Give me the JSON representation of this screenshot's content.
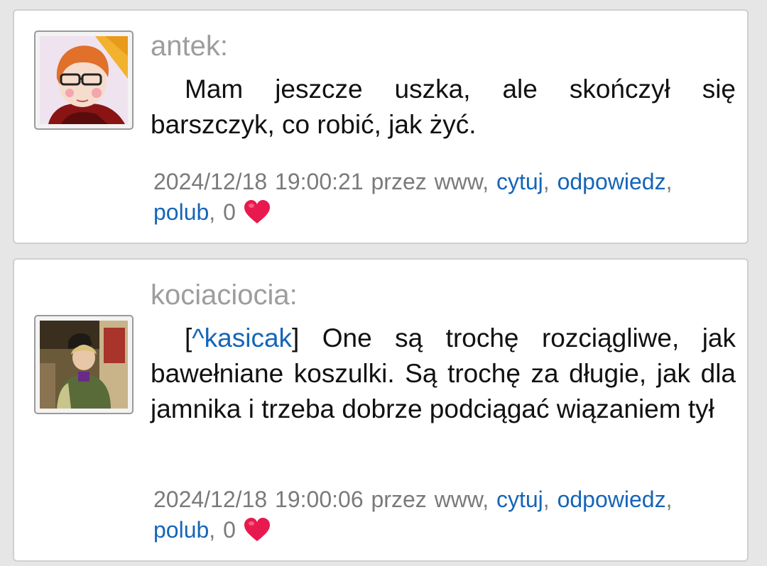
{
  "posts": [
    {
      "author": "antek:",
      "body": "Mam jeszcze uszka, ale skończył się barszczyk, co robić, jak żyć.",
      "timestamp": "2024/12/18 19:00:21",
      "via": "przez www,",
      "quote_label": "cytuj",
      "reply_label": "odpowiedz",
      "like_label": "polub",
      "like_count": "0",
      "avatar_icon": "avatar-illustrated-woman-glasses"
    },
    {
      "author": "kociaciocia:",
      "mention_open": "[",
      "mention": "^kasicak",
      "mention_close": "]",
      "body": "One są trochę rozciągliwe, jak bawełniane koszulki. Są trochę za długie, jak dla jamnika i trzeba dobrze podciągać wiązaniem tył",
      "timestamp": "2024/12/18 19:00:06",
      "via": "przez www,",
      "quote_label": "cytuj",
      "reply_label": "odpowiedz",
      "like_label": "polub",
      "like_count": "0",
      "avatar_icon": "avatar-photo-woman-with-cat"
    }
  ],
  "colors": {
    "background": "#e6e6e6",
    "card": "#ffffff",
    "author": "#9d9d9d",
    "meta": "#7a7a7a",
    "link": "#1565b8",
    "heart": "#e8194e"
  }
}
